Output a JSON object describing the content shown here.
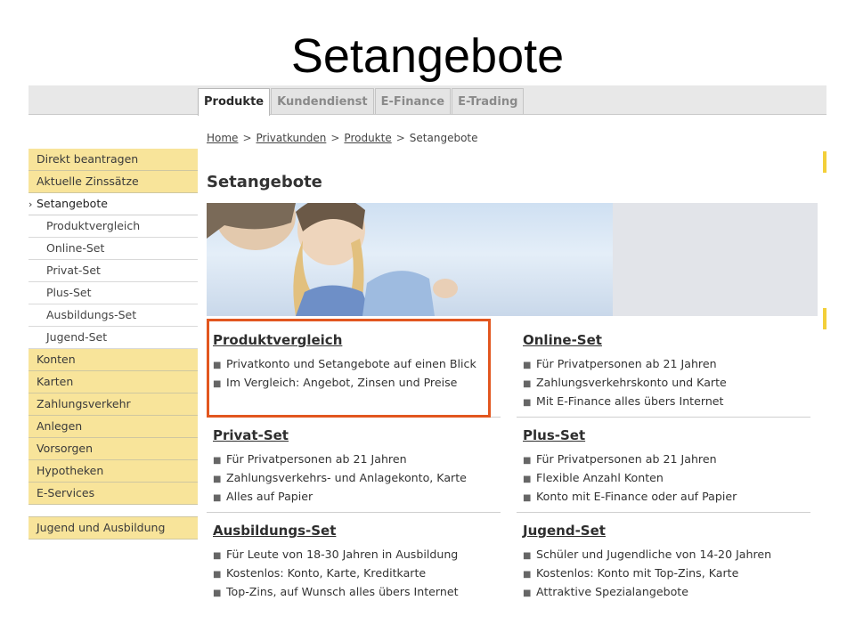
{
  "slide": {
    "title": "Setangebote"
  },
  "tabs": [
    {
      "label": "Produkte",
      "active": true
    },
    {
      "label": "Kundendienst",
      "active": false
    },
    {
      "label": "E-Finance",
      "active": false
    },
    {
      "label": "E-Trading",
      "active": false
    }
  ],
  "breadcrumb": {
    "items": [
      "Home",
      "Privatkunden",
      "Produkte"
    ],
    "current": "Setangebote",
    "separator": ">"
  },
  "page": {
    "title": "Setangebote"
  },
  "sidebar": {
    "items": [
      {
        "label": "Direkt beantragen",
        "type": "main"
      },
      {
        "label": "Aktuelle Zinssätze",
        "type": "main"
      },
      {
        "label": "Setangebote",
        "type": "current"
      },
      {
        "label": "Produktvergleich",
        "type": "sub"
      },
      {
        "label": "Online-Set",
        "type": "sub"
      },
      {
        "label": "Privat-Set",
        "type": "sub"
      },
      {
        "label": "Plus-Set",
        "type": "sub"
      },
      {
        "label": "Ausbildungs-Set",
        "type": "sub"
      },
      {
        "label": "Jugend-Set",
        "type": "sub"
      },
      {
        "label": "Konten",
        "type": "main"
      },
      {
        "label": "Karten",
        "type": "main"
      },
      {
        "label": "Zahlungsverkehr",
        "type": "main"
      },
      {
        "label": "Anlegen",
        "type": "main"
      },
      {
        "label": "Vorsorgen",
        "type": "main"
      },
      {
        "label": "Hypotheken",
        "type": "main"
      },
      {
        "label": "E-Services",
        "type": "main"
      }
    ],
    "extra": "Jugend und Ausbildung",
    "chevron_icon": "chevron-right-icon"
  },
  "products": [
    {
      "title": "Produktvergleich",
      "bullets": [
        "Privatkonto und Setangebote auf einen Blick",
        "Im Vergleich: Angebot, Zinsen und Preise"
      ]
    },
    {
      "title": "Online-Set",
      "bullets": [
        "Für Privatpersonen ab 21 Jahren",
        "Zahlungsverkehrskonto und Karte",
        "Mit E-Finance alles übers Internet"
      ]
    },
    {
      "title": "Privat-Set",
      "bullets": [
        "Für Privatpersonen ab 21 Jahren",
        "Zahlungsverkehrs- und Anlagekonto, Karte",
        "Alles auf Papier"
      ]
    },
    {
      "title": "Plus-Set",
      "bullets": [
        "Für Privatpersonen ab 21 Jahren",
        "Flexible Anzahl Konten",
        "Konto mit E-Finance oder auf Papier"
      ]
    },
    {
      "title": "Ausbildungs-Set",
      "bullets": [
        "Für Leute von 18-30 Jahren in Ausbildung",
        "Kostenlos: Konto, Karte, Kreditkarte",
        "Top-Zins, auf Wunsch alles übers Internet"
      ]
    },
    {
      "title": "Jugend-Set",
      "bullets": [
        "Schüler und Jugendliche von 14-20 Jahren",
        "Kostenlos: Konto mit Top-Zins, Karte",
        "Attraktive Spezialangebote"
      ]
    }
  ],
  "colors": {
    "nav_yellow": "#f8e49a",
    "accent_yellow": "#f3cf3a",
    "highlight_orange": "#e2561f"
  }
}
